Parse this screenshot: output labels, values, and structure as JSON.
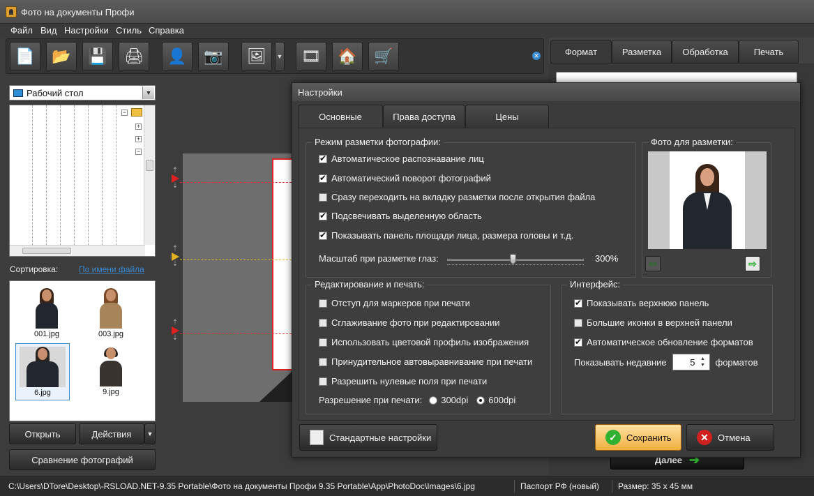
{
  "window": {
    "title": "Фото на документы Профи"
  },
  "menu": [
    "Файл",
    "Вид",
    "Настройки",
    "Стиль",
    "Справка"
  ],
  "left": {
    "folder": "Рабочий стол",
    "sort_label": "Сортировка:",
    "sort_link": "По имени файла",
    "files": [
      "001.jpg",
      "003.jpg",
      "6.jpg",
      "9.jpg"
    ],
    "selected_file": "6.jpg",
    "open_btn": "Открыть",
    "actions_btn": "Действия",
    "compare_btn": "Сравнение фотографий"
  },
  "right": {
    "tabs": [
      "Формат",
      "Разметка",
      "Обработка",
      "Печать"
    ],
    "active_tab": "Формат",
    "next_btn": "Далее"
  },
  "dialog": {
    "title": "Настройки",
    "tabs": [
      "Основные",
      "Права доступа",
      "Цены"
    ],
    "active_tab": "Основные",
    "layout_group": {
      "title": "Режим разметки фотографии:",
      "options": [
        {
          "label": "Автоматическое распознавание лиц",
          "checked": true
        },
        {
          "label": "Автоматический поворот фотографий",
          "checked": true
        },
        {
          "label": "Сразу переходить на вкладку разметки после открытия файла",
          "checked": false
        },
        {
          "label": "Подсвечивать выделенную область",
          "checked": true
        },
        {
          "label": "Показывать панель площади лица, размера головы и т.д.",
          "checked": true
        }
      ],
      "scale_label": "Масштаб при разметке глаз:",
      "scale_value": "300%",
      "scale_fraction": 0.5
    },
    "preview_group": {
      "title": "Фото для разметки:"
    },
    "edit_group": {
      "title": "Редактирование и печать:",
      "options": [
        {
          "label": "Отступ для маркеров при печати",
          "checked": false
        },
        {
          "label": "Сглаживание фото при редактировании",
          "checked": false
        },
        {
          "label": "Использовать цветовой профиль изображения",
          "checked": false
        },
        {
          "label": "Принудительное автовыравнивание при печати",
          "checked": false
        },
        {
          "label": "Разрешить нулевые поля при печати",
          "checked": false
        }
      ],
      "resolution_label": "Разрешение при печати:",
      "res_300": "300dpi",
      "res_600": "600dpi",
      "selected_resolution": "600dpi"
    },
    "interface_group": {
      "title": "Интерфейс:",
      "options": [
        {
          "label": "Показывать верхнюю панель",
          "checked": true
        },
        {
          "label": "Большие иконки в верхней панели",
          "checked": false
        },
        {
          "label": "Автоматическое обновление форматов",
          "checked": true
        }
      ],
      "recent_label": "Показывать недавние",
      "recent_value": "5",
      "recent_suffix": "форматов"
    },
    "buttons": {
      "defaults": "Стандартные настройки",
      "save": "Сохранить",
      "cancel": "Отмена"
    }
  },
  "status": {
    "path": "C:\\Users\\DTore\\Desktop\\-RSLOAD.NET-9.35 Portable\\Фото на документы Профи 9.35 Portable\\App\\PhotoDoc\\Images\\6.jpg",
    "format": "Паспорт РФ (новый)",
    "size": "Размер: 35 x 45 мм"
  },
  "colors": {
    "accent": "#3a8ad0",
    "save_btn": "#f0b040",
    "cancel_icon": "#d02020",
    "ok_icon": "#30b030"
  }
}
